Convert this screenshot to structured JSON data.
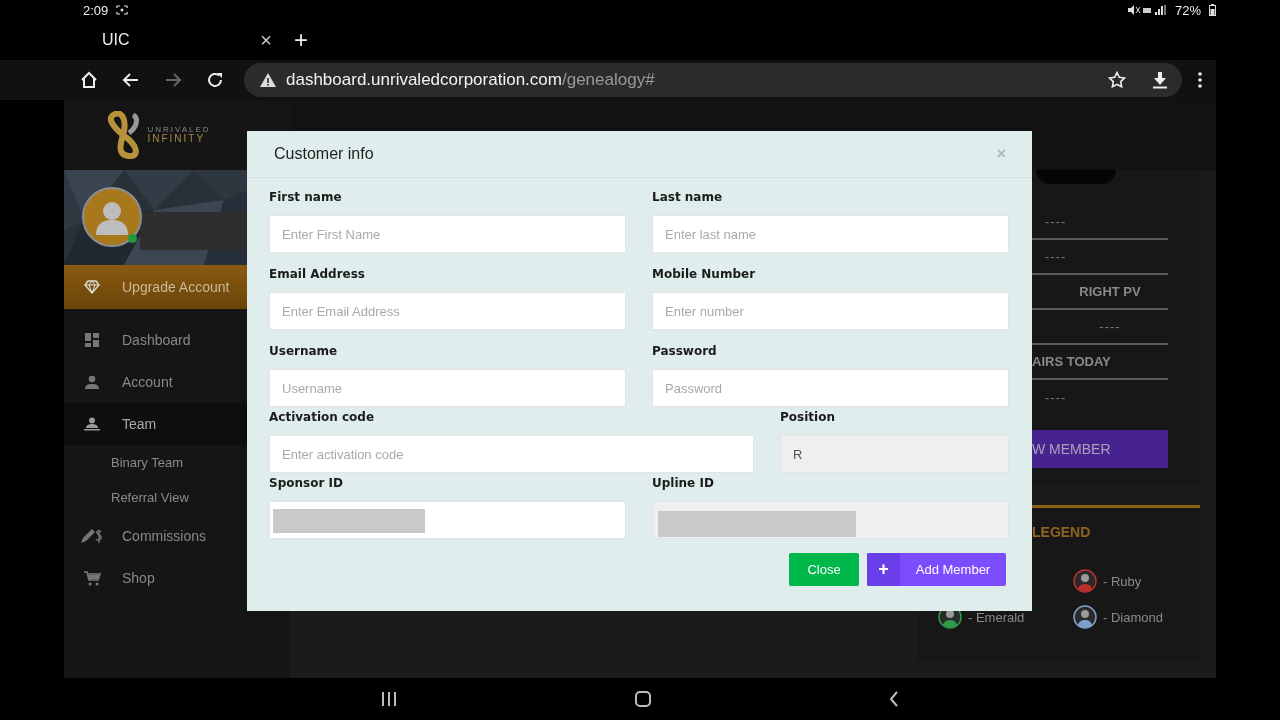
{
  "status_bar": {
    "time": "2:09",
    "battery": "72%"
  },
  "browser": {
    "tab": {
      "title": "UIC",
      "close": "×"
    },
    "new_tab": "+",
    "address": {
      "host": "dashboard.unrivaledcorporation.com",
      "path": "/genealogy#"
    },
    "forward_disabled": true
  },
  "sidebar": {
    "brand": [
      "UNRIVALED",
      "INFINITY"
    ],
    "online": true,
    "items": [
      {
        "label": "Upgrade Account",
        "kind": "upgrade",
        "selected": false
      },
      {
        "label": "Dashboard",
        "kind": "item",
        "selected": false
      },
      {
        "label": "Account",
        "kind": "item",
        "selected": false
      },
      {
        "label": "Team",
        "kind": "item",
        "selected": true,
        "children": [
          {
            "label": "Binary Team",
            "selected": false
          },
          {
            "label": "Referral View",
            "selected": false
          }
        ]
      },
      {
        "label": "Commissions",
        "kind": "item",
        "selected": false
      },
      {
        "label": "Shop",
        "kind": "item",
        "selected": false
      }
    ]
  },
  "stats": {
    "rows": [
      {
        "text": "----",
        "kind": "value",
        "centered": false
      },
      {
        "text": "----",
        "kind": "value",
        "centered": false
      },
      {
        "text": "RIGHT PV",
        "kind": "heading",
        "centered": true
      },
      {
        "text": "----",
        "kind": "value",
        "centered": true
      },
      {
        "text": "AIRS TODAY",
        "kind": "heading",
        "centered": false
      },
      {
        "text": "----",
        "kind": "value",
        "centered": false
      }
    ],
    "button": "W MEMBER"
  },
  "legend": {
    "title": "LEGEND",
    "items": [
      {
        "label": "- Ruby",
        "color": "#b8322c"
      },
      {
        "label": "- Emerald",
        "color": "#2e9a4a"
      },
      {
        "label": "- Diamond",
        "color": "#7d9fc7"
      }
    ]
  },
  "modal": {
    "title": "Customer info",
    "close": "×",
    "fields": [
      {
        "label": "First name",
        "placeholder": "Enter First Name",
        "disabled": false
      },
      {
        "label": "Last name",
        "placeholder": "Enter last name",
        "disabled": false
      },
      {
        "label": "Email Address",
        "placeholder": "Enter Email Address",
        "disabled": false
      },
      {
        "label": "Mobile Number",
        "placeholder": "Enter number",
        "disabled": false
      },
      {
        "label": "Username",
        "placeholder": "Username",
        "disabled": false
      },
      {
        "label": "Password",
        "placeholder": "Password",
        "disabled": false
      },
      {
        "label": "Activation code",
        "placeholder": "Enter activation code",
        "disabled": false
      },
      {
        "label": "Position",
        "value": "R",
        "disabled": true
      },
      {
        "label": "Sponsor ID",
        "redacted": true,
        "disabled": false
      },
      {
        "label": "Upline ID",
        "redacted": true,
        "disabled": true
      }
    ],
    "buttons": [
      {
        "label": "Close",
        "kind": "close"
      },
      {
        "label": "Add Member",
        "kind": "add",
        "icon": "+"
      }
    ]
  }
}
